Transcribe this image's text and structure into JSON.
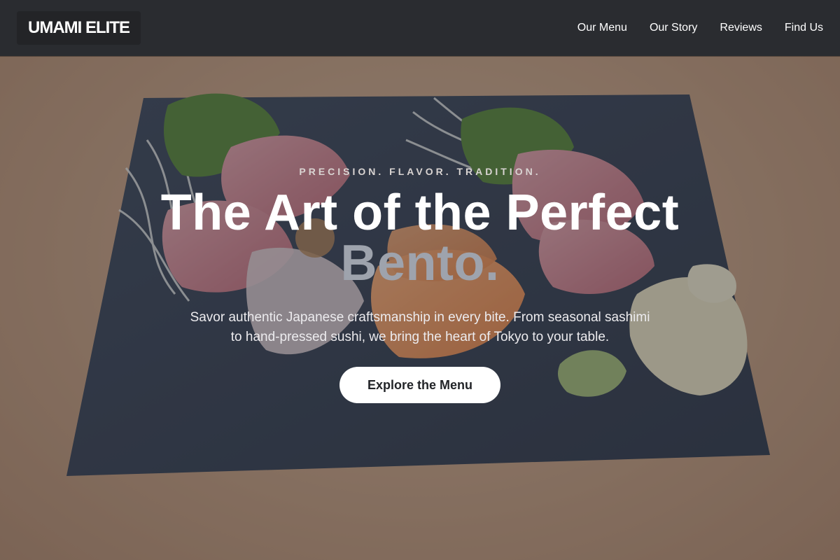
{
  "header": {
    "brand": "UMAMI ELITE",
    "nav": [
      {
        "label": "Our Menu"
      },
      {
        "label": "Our Story"
      },
      {
        "label": "Reviews"
      },
      {
        "label": "Find Us"
      }
    ]
  },
  "hero": {
    "eyebrow": "PRECISION. FLAVOR. TRADITION.",
    "title_line1": "The Art of the Perfect",
    "title_accent": "Bento.",
    "description": "Savor authentic Japanese craftsmanship in every bite. From seasonal sashimi to hand-pressed sushi, we bring the heart of Tokyo to your table.",
    "cta_label": "Explore the Menu"
  },
  "colors": {
    "header_bg": "#2a2c30",
    "accent_text": "#9ea3ad",
    "cta_bg": "#ffffff",
    "cta_text": "#222428"
  }
}
